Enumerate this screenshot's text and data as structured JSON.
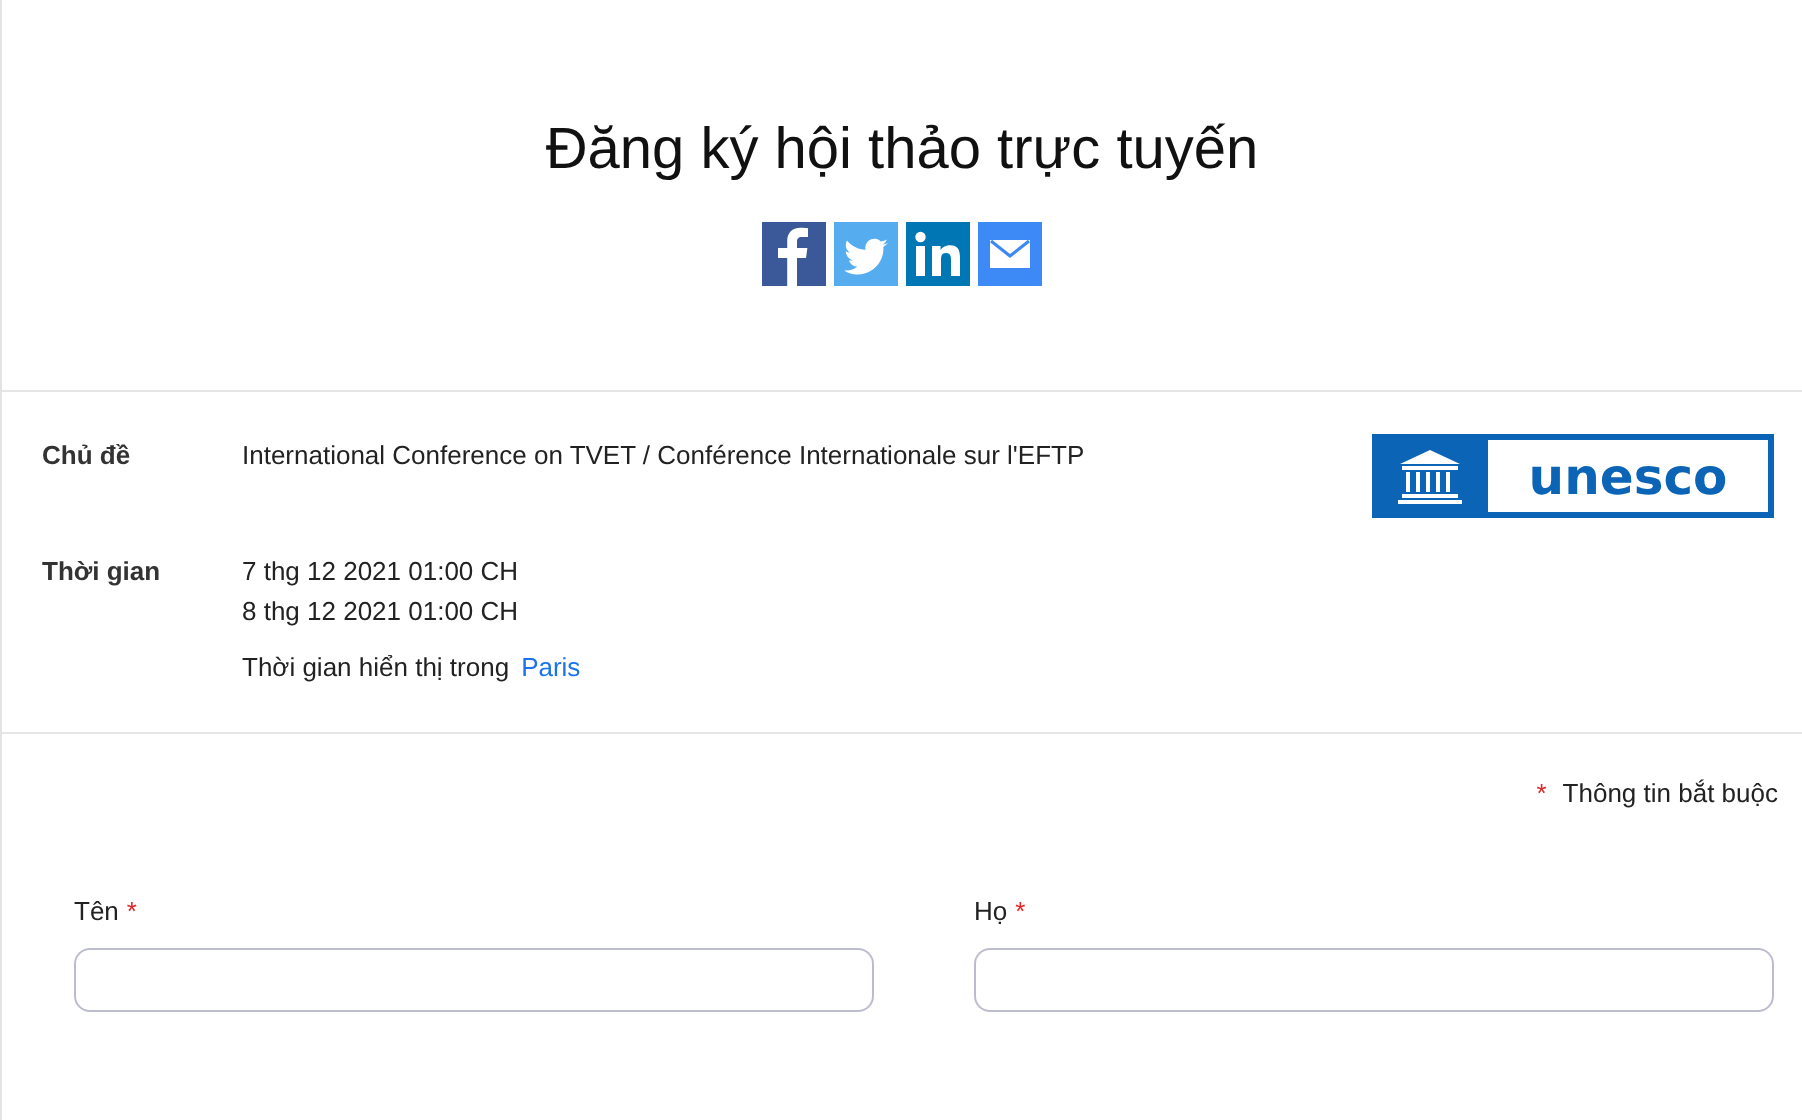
{
  "title": "Đăng ký hội thảo trực tuyến",
  "share": [
    {
      "kind": "facebook"
    },
    {
      "kind": "twitter"
    },
    {
      "kind": "linkedin"
    },
    {
      "kind": "email"
    }
  ],
  "details": [
    {
      "label": "Chủ đề",
      "lines": [
        "International Conference on TVET / Conférence Internationale sur l'EFTP"
      ]
    },
    {
      "label": "Thời gian",
      "lines": [
        "7 thg 12 2021 01:00 CH",
        "8 thg 12 2021 01:00 CH"
      ],
      "timezone_note": "Thời gian hiển thị trong",
      "timezone": "Paris"
    }
  ],
  "logo": {
    "text": "unesco"
  },
  "required_note": {
    "mark": "*",
    "text": "Thông tin bắt buộc"
  },
  "fields": [
    {
      "label": "Tên",
      "required": true
    },
    {
      "label": "Họ",
      "required": true
    }
  ]
}
